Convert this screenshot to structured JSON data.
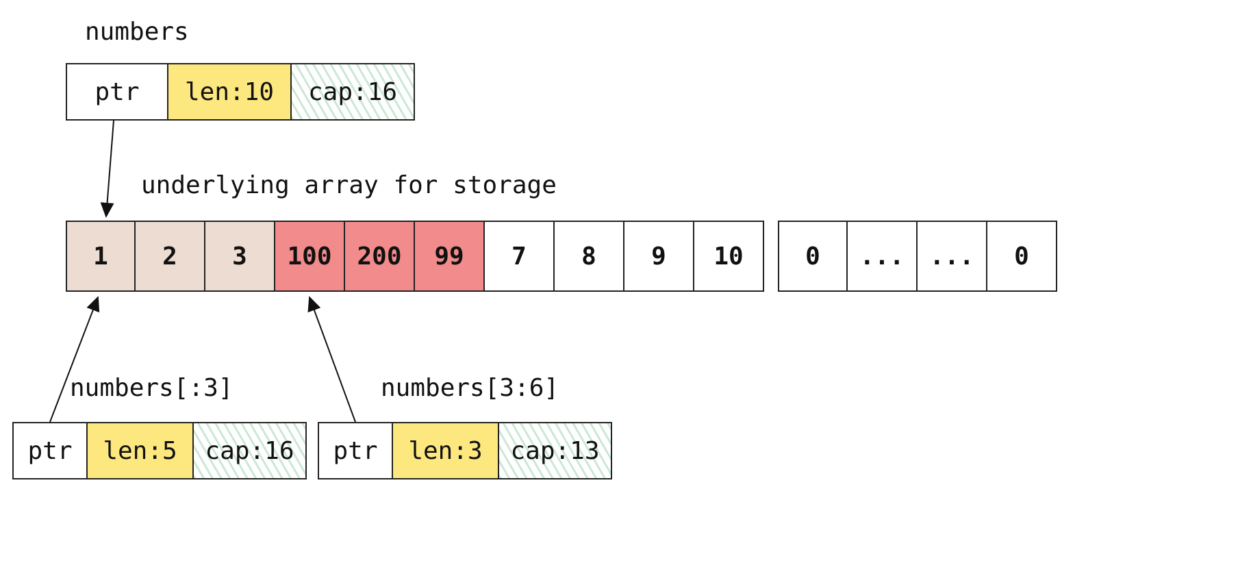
{
  "slices": {
    "numbers": {
      "title": "numbers",
      "ptr": "ptr",
      "len": "len:10",
      "cap": "cap:16"
    },
    "slice_a": {
      "title": "numbers[:3]",
      "ptr": "ptr",
      "len": "len:5",
      "cap": "cap:16"
    },
    "slice_b": {
      "title": "numbers[3:6]",
      "ptr": "ptr",
      "len": "len:3",
      "cap": "cap:13"
    }
  },
  "array": {
    "title": "underlying array for storage",
    "main": [
      "1",
      "2",
      "3",
      "100",
      "200",
      "99",
      "7",
      "8",
      "9",
      "10"
    ],
    "extra": [
      "0",
      "...",
      "...",
      "0"
    ],
    "highlight_tan_indices": [
      0,
      1,
      2
    ],
    "highlight_red_indices": [
      3,
      4,
      5
    ]
  },
  "colors": {
    "len_bg": "#fce87f",
    "cap_hatch": "#a0d4b4",
    "tan_cell": "#ecdcd1",
    "red_cell": "#f28b8b"
  }
}
